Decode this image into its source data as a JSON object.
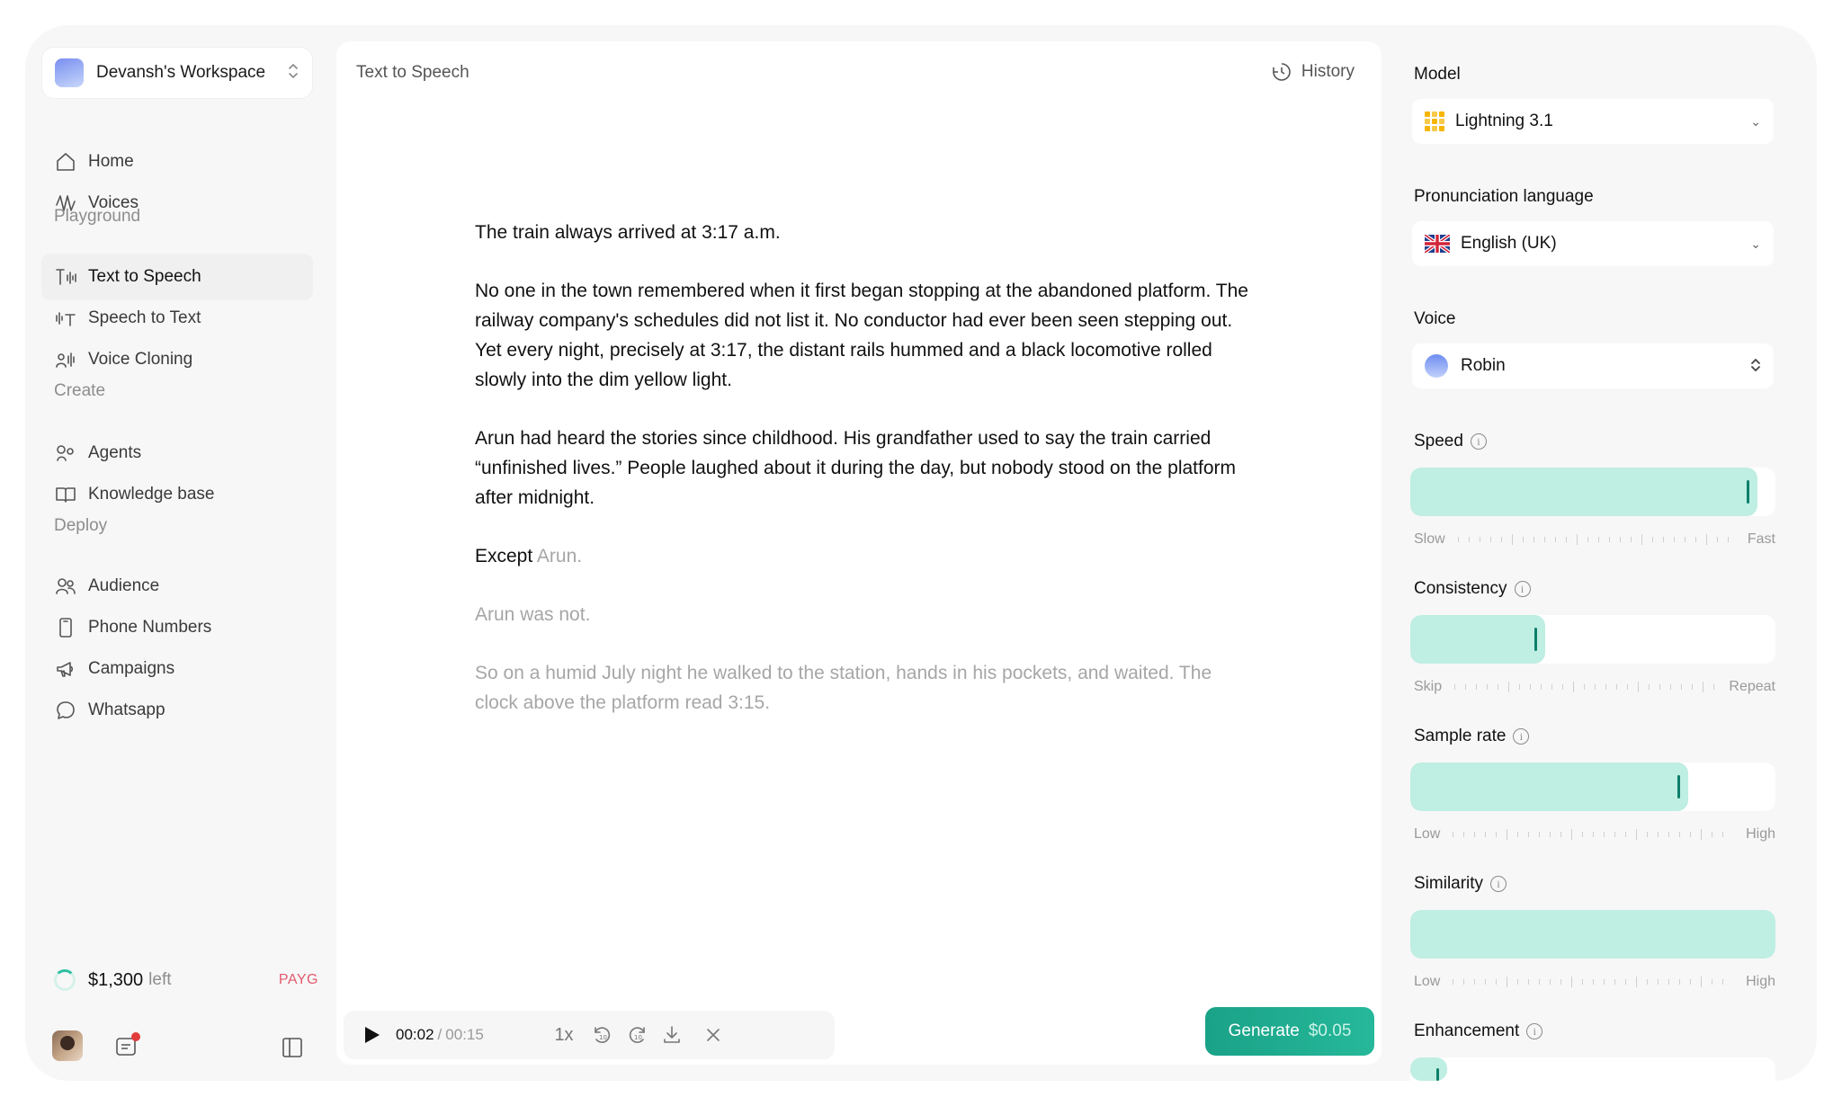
{
  "workspace": {
    "name": "Devansh's Workspace"
  },
  "nav": {
    "home": "Home",
    "voices": "Voices",
    "playground_label": "Playground",
    "tts": "Text to Speech",
    "stt": "Speech to Text",
    "cloning": "Voice Cloning",
    "create_label": "Create",
    "agents": "Agents",
    "kb": "Knowledge base",
    "deploy_label": "Deploy",
    "audience": "Audience",
    "phones": "Phone Numbers",
    "campaigns": "Campaigns",
    "whatsapp": "Whatsapp"
  },
  "credits": {
    "amount": "$1,300",
    "suffix": "left",
    "plan": "PAYG"
  },
  "main": {
    "title": "Text to Speech",
    "history": "History",
    "paragraphs": {
      "p1": "The train always arrived at 3:17 a.m.",
      "p2": "No one in the town remembered when it first began stopping at the abandoned platform. The railway company's schedules did not list it. No conductor had ever been seen stepping out. Yet every night, precisely at 3:17, the distant rails hummed and a black locomotive rolled slowly into the dim yellow light.",
      "p3": "Arun had heard the stories since childhood. His grandfather used to say the train carried “unfinished lives.” People laughed about it during the day, but nobody stood on the platform after midnight.",
      "p4a": "Except",
      "p4b": "Arun.",
      "p5": "Arun was not.",
      "p6": "So on a humid July night he walked to the station, hands in his pockets, and waited. The clock above the platform read 3:15."
    }
  },
  "player": {
    "current": "00:02",
    "separator": "/",
    "total": "00:15",
    "speed": "1x",
    "progress_fraction": 0.13
  },
  "generate": {
    "label": "Generate",
    "price": "$0.05"
  },
  "settings": {
    "model_label": "Model",
    "model_value": "Lightning 3.1",
    "lang_label": "Pronunciation language",
    "lang_value": "English (UK)",
    "voice_label": "Voice",
    "voice_value": "Robin",
    "speed": {
      "label": "Speed",
      "min": "Slow",
      "max": "Fast",
      "value": 0.95
    },
    "consistency": {
      "label": "Consistency",
      "min": "Skip",
      "max": "Repeat",
      "value": 0.37
    },
    "sample_rate": {
      "label": "Sample rate",
      "min": "Low",
      "max": "High",
      "value": 0.76
    },
    "similarity": {
      "label": "Similarity",
      "min": "Low",
      "max": "High",
      "value": 1.0
    },
    "enhancement": {
      "label": "Enhancement",
      "value": 0.1
    }
  },
  "colors": {
    "accent": "#1aa287",
    "slider_fill": "#bfeee2",
    "handle": "#0d7f6a",
    "payg": "#e25a6e"
  }
}
